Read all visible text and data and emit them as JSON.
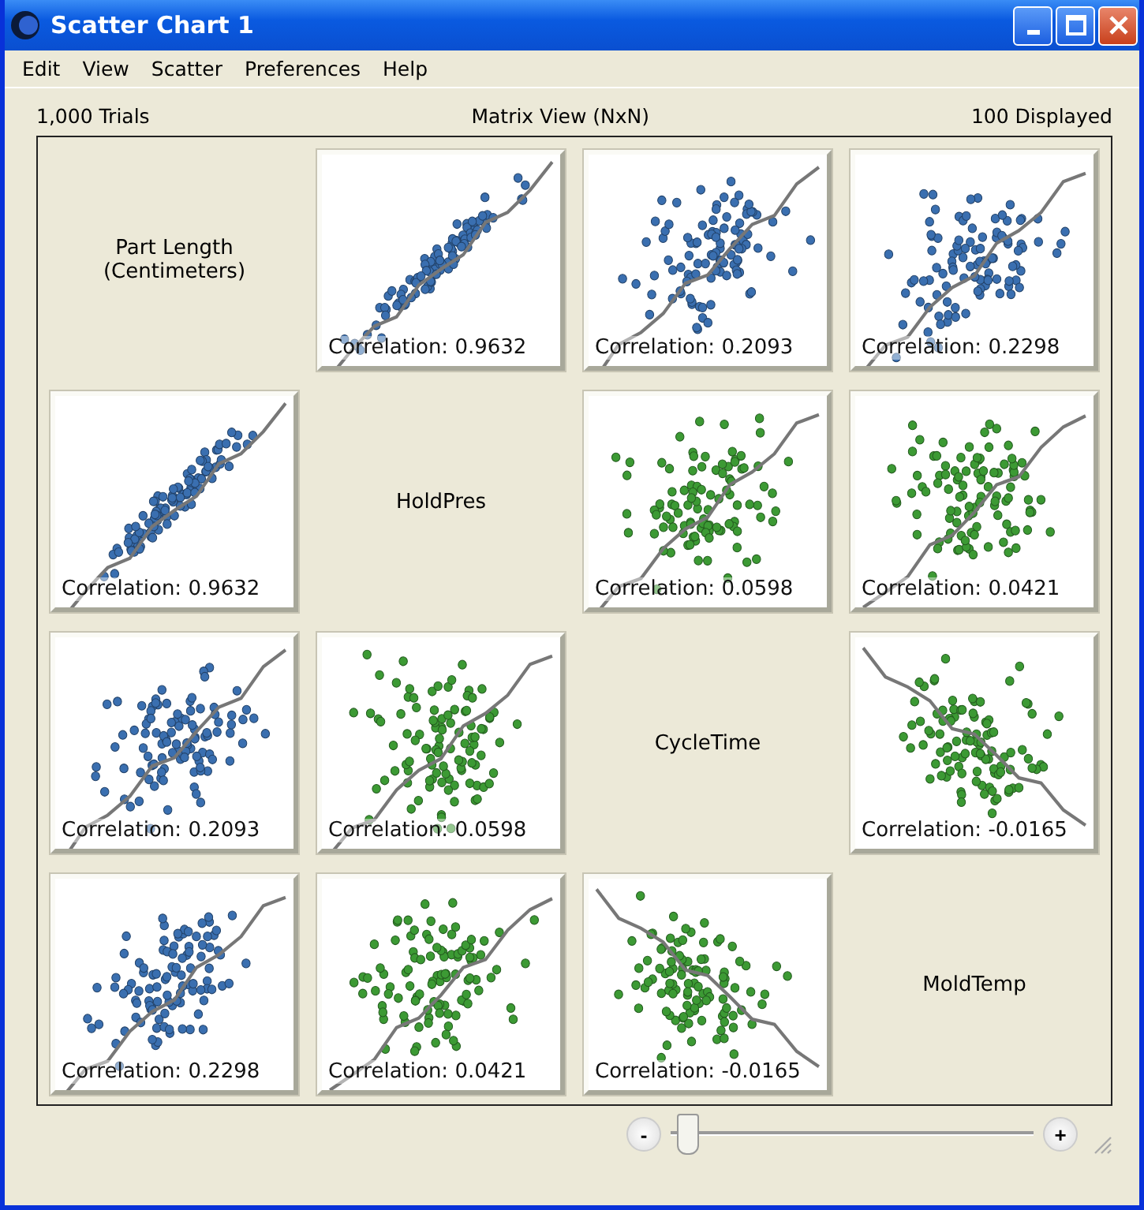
{
  "window": {
    "title": "Scatter Chart 1"
  },
  "menu": [
    "Edit",
    "View",
    "Scatter",
    "Preferences",
    "Help"
  ],
  "header": {
    "trials": "1,000 Trials",
    "view": "Matrix View (NxN)",
    "displayed": "100 Displayed"
  },
  "matrix": [
    {
      "cells": [
        {
          "kind": "label",
          "text": "Part Length\n(Centimeters)"
        },
        {
          "kind": "plot",
          "color": "#3a6fb0",
          "correlation": "Correlation: 0.9632"
        },
        {
          "kind": "plot",
          "color": "#3a6fb0",
          "correlation": "Correlation: 0.2093"
        },
        {
          "kind": "plot",
          "color": "#3a6fb0",
          "correlation": "Correlation: 0.2298"
        }
      ]
    },
    {
      "cells": [
        {
          "kind": "plot",
          "color": "#3a6fb0",
          "correlation": "Correlation: 0.9632"
        },
        {
          "kind": "label",
          "text": "HoldPres"
        },
        {
          "kind": "plot",
          "color": "#3c9a34",
          "correlation": "Correlation: 0.0598"
        },
        {
          "kind": "plot",
          "color": "#3c9a34",
          "correlation": "Correlation: 0.0421"
        }
      ]
    },
    {
      "cells": [
        {
          "kind": "plot",
          "color": "#3a6fb0",
          "correlation": "Correlation: 0.2093"
        },
        {
          "kind": "plot",
          "color": "#3c9a34",
          "correlation": "Correlation: 0.0598"
        },
        {
          "kind": "label",
          "text": "CycleTime"
        },
        {
          "kind": "plot",
          "color": "#3c9a34",
          "correlation": "Correlation: -0.0165"
        }
      ]
    },
    {
      "cells": [
        {
          "kind": "plot",
          "color": "#3a6fb0",
          "correlation": "Correlation: 0.2298"
        },
        {
          "kind": "plot",
          "color": "#3c9a34",
          "correlation": "Correlation: 0.0421"
        },
        {
          "kind": "plot",
          "color": "#3c9a34",
          "correlation": "Correlation: -0.0165"
        },
        {
          "kind": "label",
          "text": "MoldTemp"
        }
      ]
    }
  ],
  "zoom_slider": {
    "minus": "-",
    "plus": "+",
    "level": 0.02
  }
}
